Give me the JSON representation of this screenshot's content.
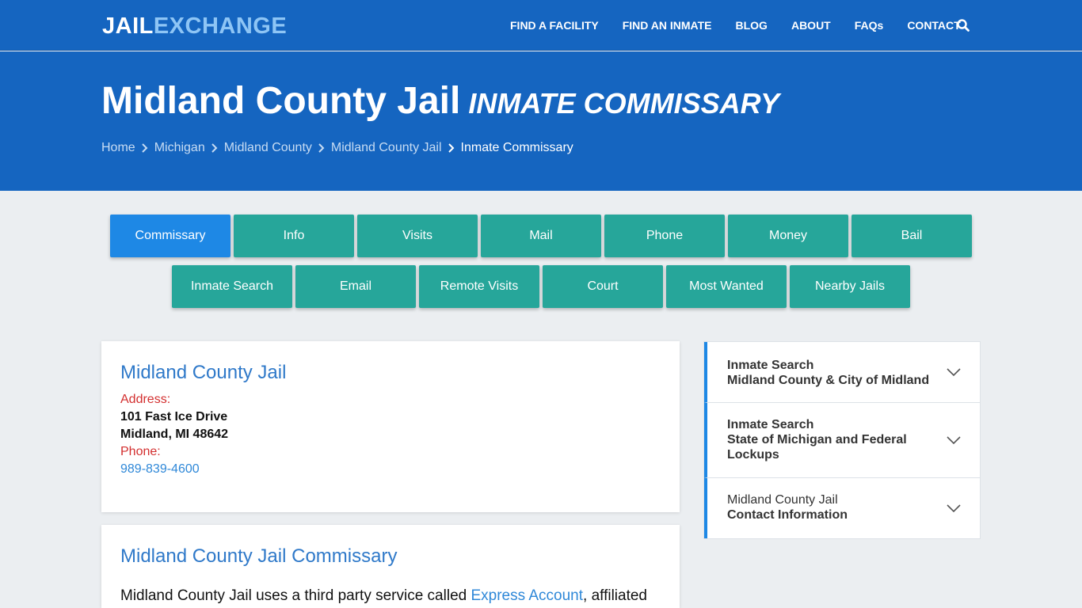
{
  "header": {
    "logo_part1": "JAIL",
    "logo_part2": "EXCHANGE",
    "nav": [
      "FIND A FACILITY",
      "FIND AN INMATE",
      "BLOG",
      "ABOUT",
      "FAQs",
      "CONTACT"
    ],
    "search_icon": "search-icon"
  },
  "hero": {
    "title": "Midland County Jail",
    "subtitle": "INMATE COMMISSARY",
    "breadcrumbs": [
      "Home",
      "Michigan",
      "Midland County",
      "Midland County Jail"
    ],
    "breadcrumb_current": "Inmate Commissary"
  },
  "tabs": {
    "row1": [
      "Commissary",
      "Info",
      "Visits",
      "Mail",
      "Phone",
      "Money",
      "Bail"
    ],
    "row2": [
      "Inmate Search",
      "Email",
      "Remote Visits",
      "Court",
      "Most Wanted",
      "Nearby Jails"
    ],
    "active": "Commissary"
  },
  "facility": {
    "name": "Midland County Jail",
    "address_label": "Address:",
    "address_line1": "101 Fast Ice Drive",
    "address_line2": "Midland, MI 48642",
    "phone_label": "Phone:",
    "phone": "989-839-4600"
  },
  "commissary": {
    "heading": "Midland County Jail Commissary",
    "text_before": "Midland County Jail uses a third party service called ",
    "link": "Express Account",
    "text_after": ", affiliated"
  },
  "sidebar": {
    "items": [
      {
        "line1": "Inmate Search",
        "line2": "Midland County & City of Midland"
      },
      {
        "line1": "Inmate Search",
        "line2": "State of Michigan and Federal",
        "line3": "Lockups"
      },
      {
        "line1": "Midland County Jail",
        "line2": "Contact Information"
      }
    ]
  },
  "colors": {
    "header_blue": "#1565c0",
    "tab_teal": "#26a69a",
    "tab_active": "#1e88e5",
    "link_blue": "#2f88d8",
    "label_red": "#d32f2f"
  }
}
